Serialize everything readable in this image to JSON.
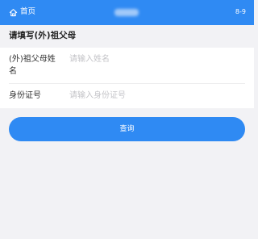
{
  "header": {
    "home_label": "首页",
    "home_icon": "home-icon",
    "page_indicator": "8-9",
    "background": "#2f8af3"
  },
  "section": {
    "title": "请填写(外)祖父母"
  },
  "form": {
    "name_label": "(外)祖父母姓名",
    "name_placeholder": "请输入姓名",
    "id_label": "身份证号",
    "id_placeholder": "请输入身份证号"
  },
  "actions": {
    "query_label": "查询",
    "accent": "#2f8af3"
  }
}
